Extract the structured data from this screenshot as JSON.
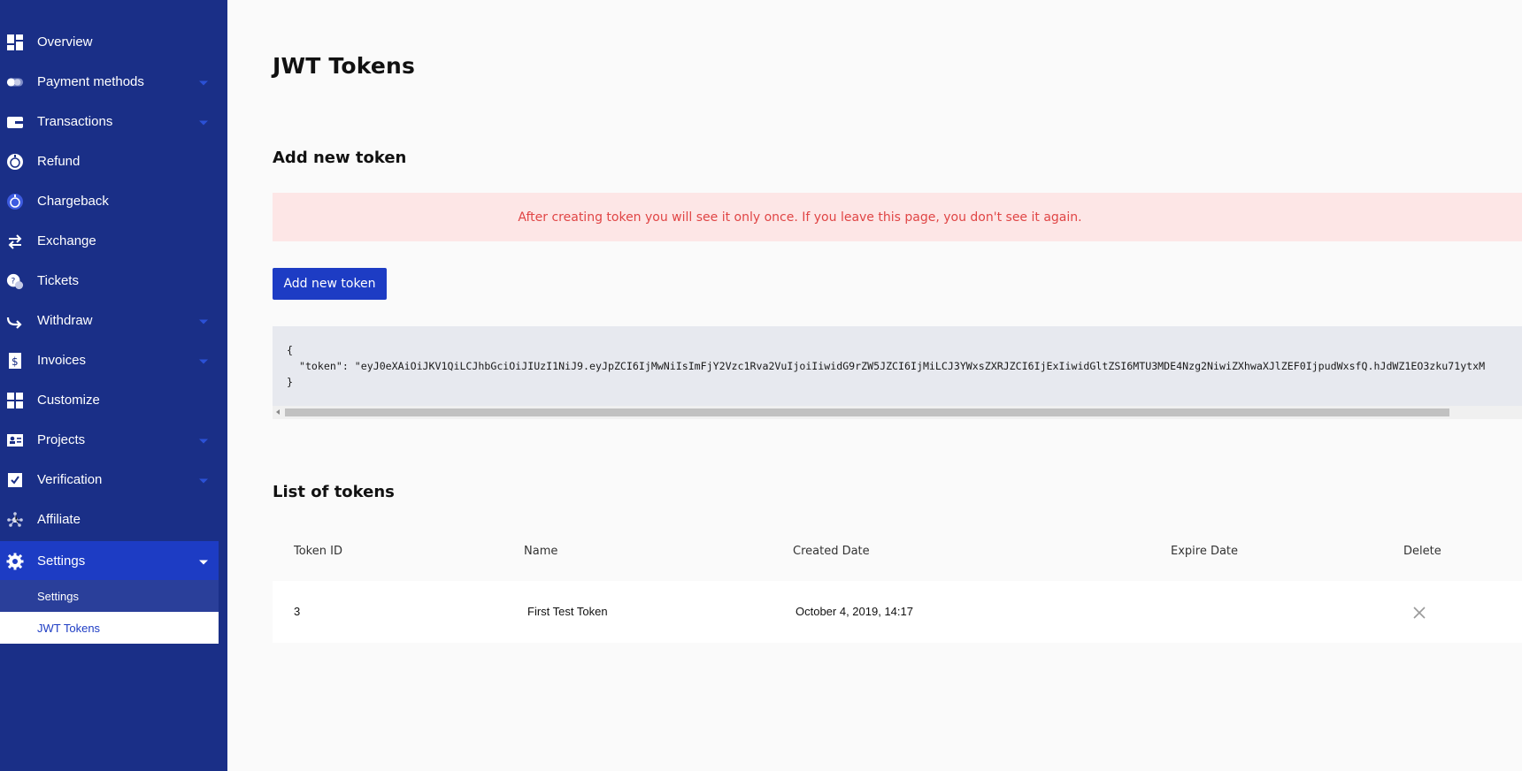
{
  "sidebar": {
    "items": [
      {
        "label": "Overview",
        "icon": "overview-icon",
        "has_caret": false
      },
      {
        "label": "Payment methods",
        "icon": "payment-methods-icon",
        "has_caret": true
      },
      {
        "label": "Transactions",
        "icon": "wallet-icon",
        "has_caret": true
      },
      {
        "label": "Refund",
        "icon": "refund-icon",
        "has_caret": false
      },
      {
        "label": "Chargeback",
        "icon": "chargeback-icon",
        "has_caret": false
      },
      {
        "label": "Exchange",
        "icon": "exchange-icon",
        "has_caret": false
      },
      {
        "label": "Tickets",
        "icon": "tickets-icon",
        "has_caret": false
      },
      {
        "label": "Withdraw",
        "icon": "withdraw-icon",
        "has_caret": true
      },
      {
        "label": "Invoices",
        "icon": "invoice-icon",
        "has_caret": true
      },
      {
        "label": "Customize",
        "icon": "customize-icon",
        "has_caret": false
      },
      {
        "label": "Projects",
        "icon": "projects-icon",
        "has_caret": true
      },
      {
        "label": "Verification",
        "icon": "verification-icon",
        "has_caret": true
      },
      {
        "label": "Affiliate",
        "icon": "affiliate-icon",
        "has_caret": false
      },
      {
        "label": "Settings",
        "icon": "gear-icon",
        "has_caret": true,
        "active": true
      }
    ],
    "subitems": [
      {
        "label": "Settings"
      },
      {
        "label": "JWT Tokens",
        "selected": true
      }
    ]
  },
  "main": {
    "title": "JWT Tokens",
    "add_section_title": "Add new token",
    "alert_text": "After creating token you will see it only once. If you leave this page, you don't see it again.",
    "add_button_label": "Add new token",
    "code_lines": [
      "{",
      "  \"token\": \"eyJ0eXAiOiJKV1QiLCJhbGciOiJIUzI1NiJ9.eyJpZCI6IjMwNiIsImFjY2Vzc1Rva2VuIjoiIiwidG9rZW5JZCI6IjMiLCJ3YWxsZXRJZCI6IjExIiwidGltZSI6MTU3MDE4Nzg2NiwiZXhwaXJlZEF0IjpudWxsfQ.hJdWZ1EO3zku71ytxM",
      "}"
    ],
    "list_section_title": "List of tokens",
    "table": {
      "headers": [
        "Token ID",
        "Name",
        "Created Date",
        "Expire Date",
        "Delete"
      ],
      "rows": [
        {
          "token_id": "3",
          "name": "First Test Token",
          "created": "October 4, 2019, 14:17",
          "expire": "",
          "delete_icon": "close-icon"
        }
      ]
    }
  },
  "colors": {
    "sidebar_bg": "#1a2f87",
    "active_item": "#1d3cc4",
    "accent": "#1d3cc4",
    "alert_bg": "#fde6e6",
    "alert_text": "#e04545",
    "code_bg": "#e7e9ef"
  }
}
